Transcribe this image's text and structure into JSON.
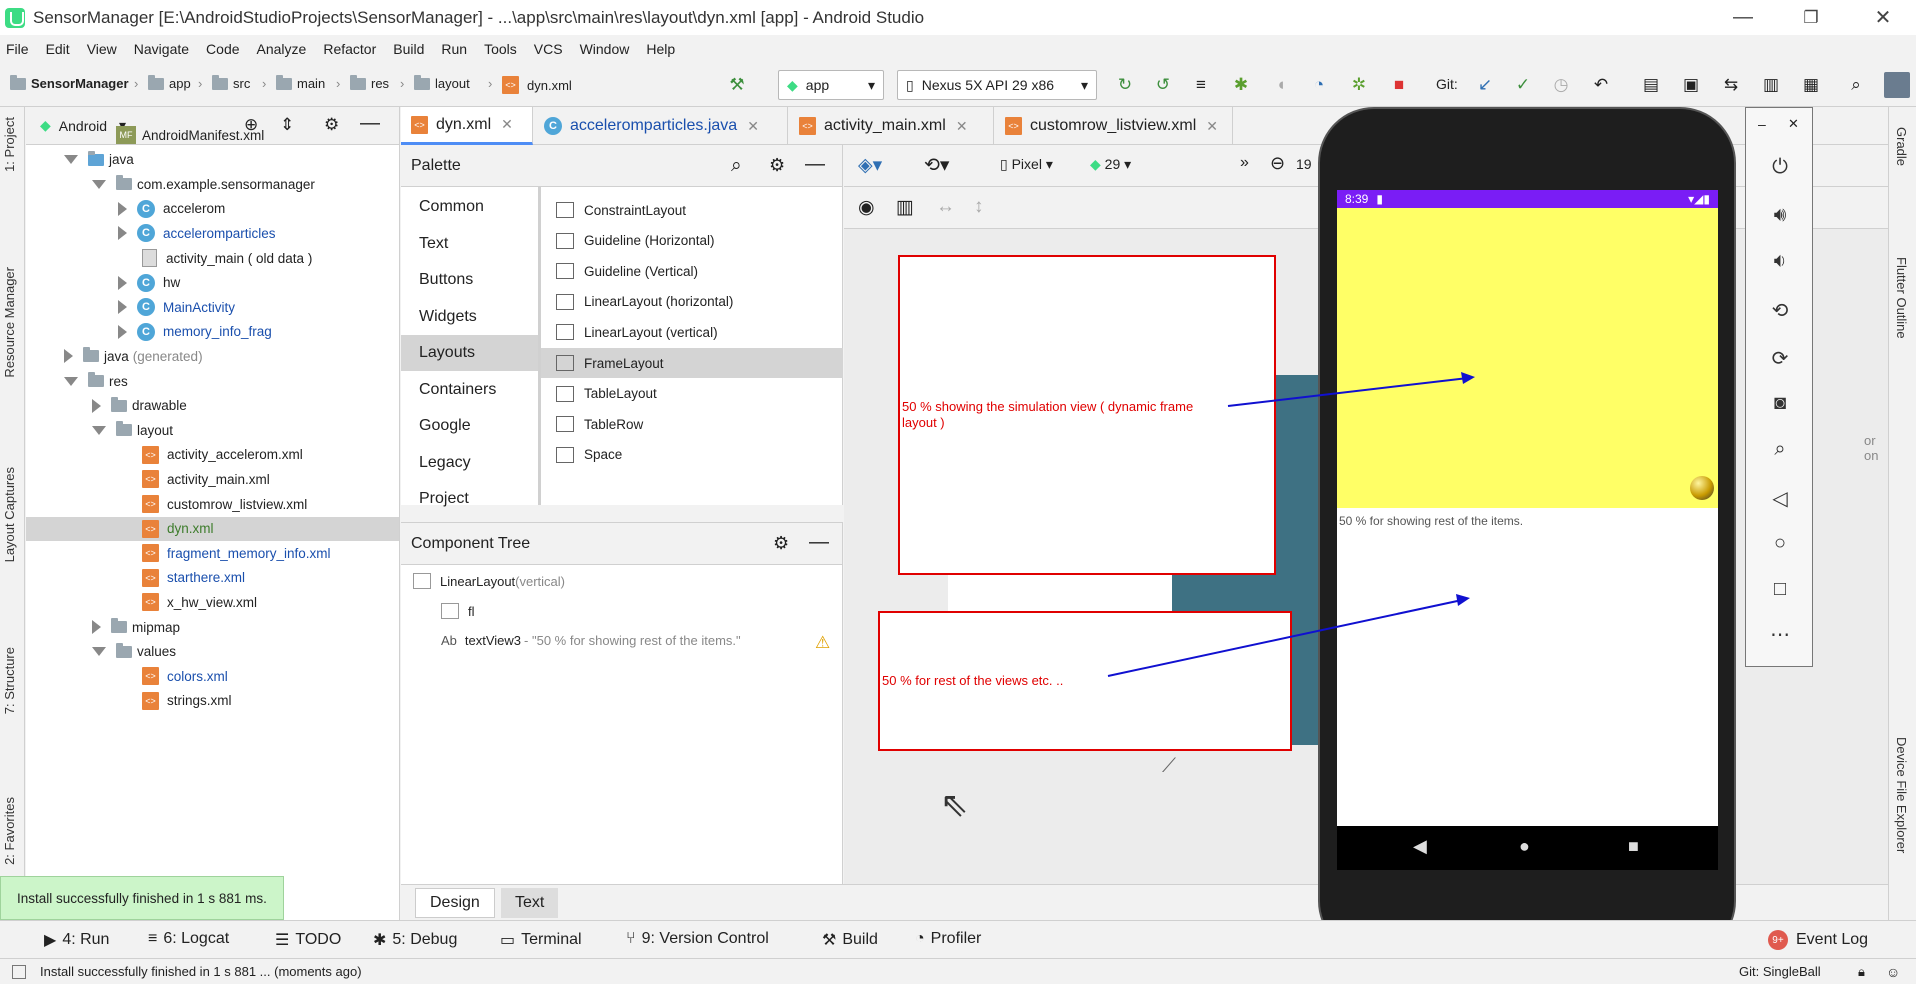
{
  "window": {
    "title": "SensorManager [E:\\AndroidStudioProjects\\SensorManager] - ...\\app\\src\\main\\res\\layout\\dyn.xml [app] - Android Studio",
    "minimize": "—",
    "restore": "❐",
    "close": "✕"
  },
  "menu": [
    "File",
    "Edit",
    "View",
    "Navigate",
    "Code",
    "Analyze",
    "Refactor",
    "Build",
    "Run",
    "Tools",
    "VCS",
    "Window",
    "Help"
  ],
  "breadcrumb": [
    "SensorManager",
    "app",
    "src",
    "main",
    "res",
    "layout",
    "dyn.xml"
  ],
  "toolbar": {
    "run_config": "app",
    "device": "Nexus 5X API 29 x86",
    "git_label": "Git:"
  },
  "left_tabs": [
    "1: Project",
    "Resource Manager",
    "Layout Captures",
    "7: Structure",
    "2: Favorites"
  ],
  "right_tabs": [
    "Gradle",
    "Flutter Outline",
    "Device File Explorer"
  ],
  "project": {
    "view": "Android",
    "rows": [
      {
        "label": "AndroidManifest.xml",
        "icon": "manifest",
        "indent": 2,
        "expand": "none",
        "color": "default"
      },
      {
        "label": "java",
        "icon": "folder-blue",
        "indent": 1,
        "expand": "down",
        "color": "default"
      },
      {
        "label": "com.example.sensormanager",
        "icon": "folder",
        "indent": 2,
        "expand": "down",
        "color": "default"
      },
      {
        "label": "accelerom",
        "icon": "class",
        "indent": 3,
        "expand": "right",
        "color": "default"
      },
      {
        "label": "acceleromparticles",
        "icon": "class",
        "indent": 3,
        "expand": "right",
        "color": "blue"
      },
      {
        "label": "activity_main ( old data )",
        "icon": "file",
        "indent": 3,
        "expand": "none",
        "color": "default"
      },
      {
        "label": "hw",
        "icon": "class",
        "indent": 3,
        "expand": "right",
        "color": "default"
      },
      {
        "label": "MainActivity",
        "icon": "class",
        "indent": 3,
        "expand": "right",
        "color": "blue"
      },
      {
        "label": "memory_info_frag",
        "icon": "class",
        "indent": 3,
        "expand": "right",
        "color": "blue"
      },
      {
        "label": "java",
        "suffix": "(generated)",
        "icon": "folder-gen",
        "indent": 1,
        "expand": "right",
        "color": "default"
      },
      {
        "label": "res",
        "icon": "folder",
        "indent": 1,
        "expand": "down",
        "color": "default"
      },
      {
        "label": "drawable",
        "icon": "folder",
        "indent": 2,
        "expand": "right",
        "color": "default"
      },
      {
        "label": "layout",
        "icon": "folder",
        "indent": 2,
        "expand": "down",
        "color": "default"
      },
      {
        "label": "activity_accelerom.xml",
        "icon": "xml",
        "indent": 3,
        "expand": "none",
        "color": "default"
      },
      {
        "label": "activity_main.xml",
        "icon": "xml",
        "indent": 3,
        "expand": "none",
        "color": "default"
      },
      {
        "label": "customrow_listview.xml",
        "icon": "xml",
        "indent": 3,
        "expand": "none",
        "color": "default"
      },
      {
        "label": "dyn.xml",
        "icon": "xml",
        "indent": 3,
        "expand": "none",
        "color": "green",
        "selected": true
      },
      {
        "label": "fragment_memory_info.xml",
        "icon": "xml",
        "indent": 3,
        "expand": "none",
        "color": "blue"
      },
      {
        "label": "starthere.xml",
        "icon": "xml",
        "indent": 3,
        "expand": "none",
        "color": "blue"
      },
      {
        "label": "x_hw_view.xml",
        "icon": "xml",
        "indent": 3,
        "expand": "none",
        "color": "default"
      },
      {
        "label": "mipmap",
        "icon": "folder",
        "indent": 2,
        "expand": "right",
        "color": "default"
      },
      {
        "label": "values",
        "icon": "folder",
        "indent": 2,
        "expand": "down",
        "color": "default"
      },
      {
        "label": "colors.xml",
        "icon": "xml",
        "indent": 3,
        "expand": "none",
        "color": "blue"
      },
      {
        "label": "strings.xml",
        "icon": "xml",
        "indent": 3,
        "expand": "none",
        "color": "default"
      }
    ]
  },
  "editor_tabs": [
    {
      "label": "dyn.xml",
      "active": true
    },
    {
      "label": "acceleromparticles.java",
      "active": false
    },
    {
      "label": "activity_main.xml",
      "active": false
    },
    {
      "label": "customrow_listview.xml",
      "active": false
    }
  ],
  "palette": {
    "title": "Palette",
    "categories": [
      "Common",
      "Text",
      "Buttons",
      "Widgets",
      "Layouts",
      "Containers",
      "Google",
      "Legacy",
      "Project"
    ],
    "selected_category": "Layouts",
    "items": [
      "ConstraintLayout",
      "Guideline (Horizontal)",
      "Guideline (Vertical)",
      "LinearLayout (horizontal)",
      "LinearLayout (vertical)",
      "FrameLayout",
      "TableLayout",
      "TableRow",
      "Space"
    ],
    "selected_item": "FrameLayout"
  },
  "component_tree": {
    "title": "Component Tree",
    "root": "LinearLayout",
    "root_suffix": "(vertical)",
    "child1": "fl",
    "child2": "textView3",
    "child2_text": "- \"50 % for showing rest of the items.\""
  },
  "design_toolbar": {
    "device": "Pixel",
    "api": "29",
    "zoom_partial": "19"
  },
  "annotations": {
    "box1": "50 % showing the simulation view ( dynamic frame layout )",
    "box2": "50 % for rest of the views etc. .."
  },
  "phone": {
    "time": "8:39",
    "bottom_text": "50 % for showing rest of the items.",
    "status_bar_color": "#7a1df5",
    "frame_color": "#ffff66"
  },
  "behind_text": "or on",
  "design_tabs": [
    "Design",
    "Text"
  ],
  "bottom_tools": [
    {
      "label": "4: Run",
      "icon": "run-icon"
    },
    {
      "label": "6: Logcat",
      "icon": "logcat-icon"
    },
    {
      "label": "TODO",
      "icon": "todo-icon"
    },
    {
      "label": "5: Debug",
      "icon": "debug-icon"
    },
    {
      "label": "Terminal",
      "icon": "terminal-icon"
    },
    {
      "label": "9: Version Control",
      "icon": "vcs-icon"
    },
    {
      "label": "Build",
      "icon": "build-icon"
    },
    {
      "label": "Profiler",
      "icon": "profiler-icon"
    }
  ],
  "event_log": {
    "label": "Event Log",
    "badge": "9+"
  },
  "notification": "Install successfully finished in 1 s 881 ms.",
  "status": {
    "message": "Install successfully finished in 1 s 881 ... (moments ago)",
    "git": "Git: SingleBall"
  }
}
